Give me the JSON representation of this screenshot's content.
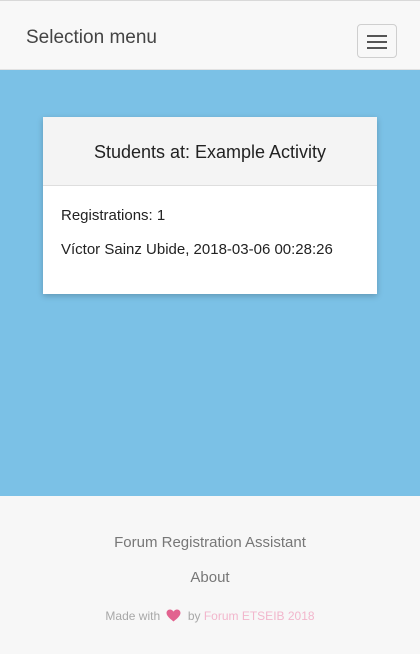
{
  "navbar": {
    "brand": "Selection menu",
    "toggle_icon": "hamburger-menu-icon"
  },
  "card": {
    "title": "Students at: Example Activity",
    "registrations": "Registrations: 1",
    "entries": [
      "Víctor Sainz Ubide, 2018-03-06 00:28:26"
    ]
  },
  "footer": {
    "app_name": "Forum Registration Assistant",
    "about": "About",
    "made_with": "Made with",
    "heart_icon": "heart-icon",
    "by": "by",
    "credit_link": "Forum ETSEIB 2018"
  },
  "colors": {
    "main_background": "#7bc1e6",
    "navbar_background": "#f8f8f8",
    "footer_background": "#f7f7f7",
    "heart": "#e2638f",
    "credit_link": "#f2b6cc"
  }
}
